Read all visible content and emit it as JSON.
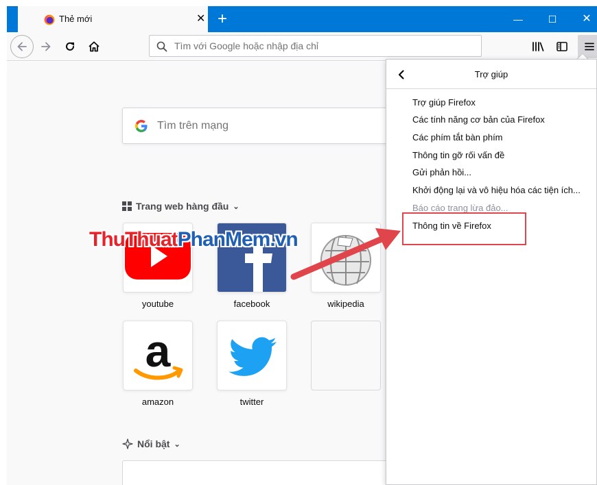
{
  "tab": {
    "title": "Thẻ mới",
    "icon": "firefox-logo-icon"
  },
  "toolbar": {
    "url_placeholder": "Tìm với Google hoặc nhập địa chỉ",
    "icons": [
      "back-icon",
      "forward-icon",
      "reload-icon",
      "home-icon",
      "library-icon",
      "sidebar-icon",
      "menu-icon"
    ]
  },
  "newtab": {
    "search_placeholder": "Tìm trên mạng",
    "top_sites_title": "Trang web hàng đầu",
    "highlights_title": "Nổi bật",
    "top_sites": [
      {
        "label": "youtube"
      },
      {
        "label": "facebook"
      },
      {
        "label": "wikipedia"
      },
      {
        "label": "amazon"
      },
      {
        "label": "twitter"
      }
    ]
  },
  "help_panel": {
    "title": "Trợ giúp",
    "items": [
      {
        "label": "Trợ giúp Firefox",
        "enabled": true
      },
      {
        "label": "Các tính năng cơ bản của Firefox",
        "enabled": true
      },
      {
        "label": "Các phím tắt bàn phím",
        "enabled": true
      },
      {
        "label": "Thông tin gỡ rối vấn đề",
        "enabled": true
      },
      {
        "label": "Gửi phản hồi...",
        "enabled": true
      },
      {
        "label": "Khởi động lại và vô hiệu hóa các tiện ích...",
        "enabled": true
      },
      {
        "label": "Báo cáo trang lừa đảo...",
        "enabled": false
      },
      {
        "label": "Thông tin về Firefox",
        "enabled": true,
        "highlighted": true
      }
    ]
  },
  "watermark": {
    "part1": "ThuThuat",
    "part2": "PhanMem.vn"
  },
  "colors": {
    "titlebar": "#0078d7",
    "annotation_red": "#e0454b",
    "youtube_red": "#ff0000",
    "facebook_blue": "#3b5998",
    "twitter_blue": "#1da1f2",
    "amazon_orange": "#f90"
  }
}
